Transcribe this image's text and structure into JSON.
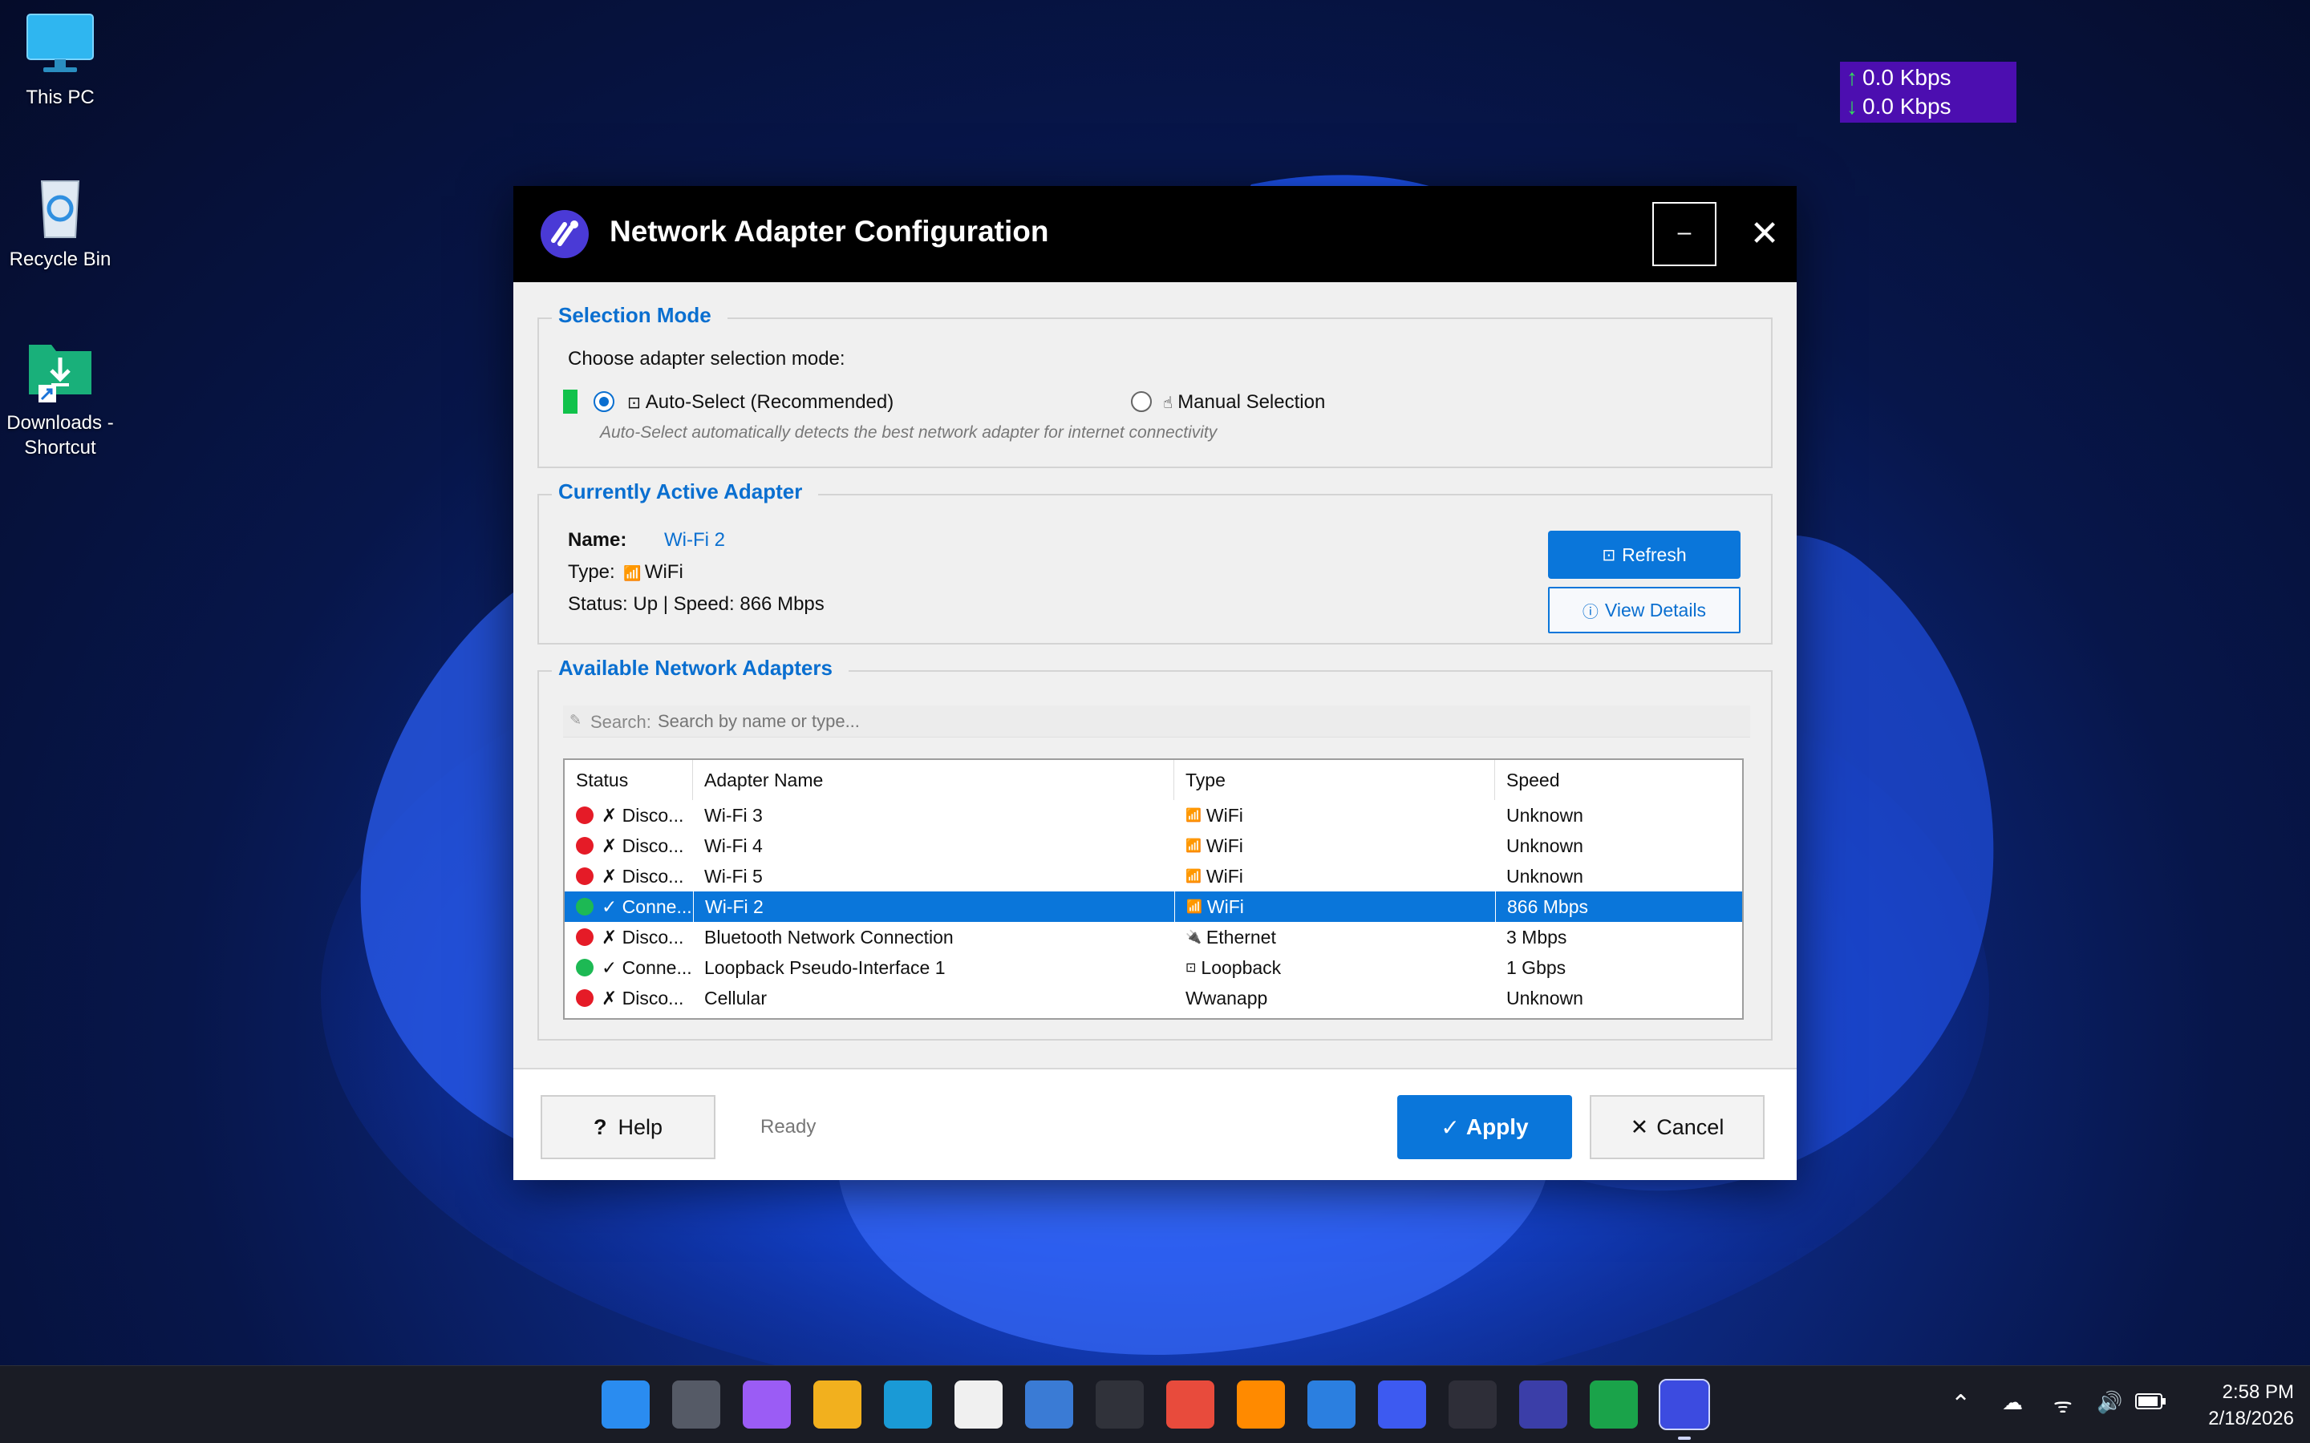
{
  "desktop": {
    "icons": [
      {
        "label": "This PC"
      },
      {
        "label": "Recycle Bin"
      },
      {
        "label": "Downloads - Shortcut"
      }
    ]
  },
  "netspeed": {
    "up": "0.0 Kbps",
    "down": "0.0 Kbps"
  },
  "dialog": {
    "title": "Network Adapter Configuration",
    "minimize_glyph": "–",
    "close_glyph": "✕",
    "selection_mode": {
      "legend": "Selection Mode",
      "prompt": "Choose adapter selection mode:",
      "auto_label": "Auto-Select (Recommended)",
      "auto_icon": "⊡",
      "manual_label": "Manual Selection",
      "manual_icon": "☝",
      "hint": "Auto-Select automatically detects the best network adapter for internet connectivity",
      "selected": "auto"
    },
    "active_adapter": {
      "legend": "Currently Active Adapter",
      "name_label": "Name:",
      "name_value": "Wi-Fi 2",
      "type_label": "Type:",
      "type_icon": "📶",
      "type_value": "WiFi",
      "status_text": "Status: Up | Speed: 866 Mbps",
      "refresh_label": "Refresh",
      "refresh_icon": "⊡",
      "details_label": "View Details",
      "details_icon": "ⓘ"
    },
    "available": {
      "legend": "Available Network Adapters",
      "search_label": "Search:",
      "search_placeholder": "Search by name or type...",
      "search_value": "",
      "columns": [
        "Status",
        "Adapter Name",
        "Type",
        "Speed"
      ],
      "rows": [
        {
          "status_color": "red",
          "status": "✗ Disco...",
          "name": "Wi-Fi 3",
          "type_icon": "📶",
          "type": "WiFi",
          "speed": "Unknown",
          "selected": false
        },
        {
          "status_color": "red",
          "status": "✗ Disco...",
          "name": "Wi-Fi 4",
          "type_icon": "📶",
          "type": "WiFi",
          "speed": "Unknown",
          "selected": false
        },
        {
          "status_color": "red",
          "status": "✗ Disco...",
          "name": "Wi-Fi 5",
          "type_icon": "📶",
          "type": "WiFi",
          "speed": "Unknown",
          "selected": false
        },
        {
          "status_color": "green",
          "status": "✓ Conne...",
          "name": "Wi-Fi 2",
          "type_icon": "📶",
          "type": "WiFi",
          "speed": "866 Mbps",
          "selected": true
        },
        {
          "status_color": "red",
          "status": "✗ Disco...",
          "name": "Bluetooth Network Connection",
          "type_icon": "🔌",
          "type": "Ethernet",
          "speed": "3 Mbps",
          "selected": false
        },
        {
          "status_color": "green",
          "status": "✓ Conne...",
          "name": "Loopback Pseudo-Interface 1",
          "type_icon": "⊡",
          "type": "Loopback",
          "speed": "1 Gbps",
          "selected": false
        },
        {
          "status_color": "red",
          "status": "✗ Disco...",
          "name": "Cellular",
          "type_icon": "",
          "type": "Wwanapp",
          "speed": "Unknown",
          "selected": false
        }
      ]
    },
    "footer": {
      "help_label": "Help",
      "help_icon": "?",
      "status": "Ready",
      "apply_label": "Apply",
      "apply_icon": "✓",
      "cancel_label": "Cancel",
      "cancel_icon": "✕"
    }
  },
  "taskbar": {
    "apps": [
      "start-icon",
      "task-view-icon",
      "copilot-icon",
      "file-explorer-icon",
      "edge-icon",
      "store-icon",
      "control-panel-icon",
      "terminal-icon",
      "chrome-icon",
      "sublime-icon",
      "vscode-icon",
      "remote-desktop-icon",
      "speedometer-icon",
      "system-info-icon",
      "net-updown-icon",
      "network-adapter-app-icon"
    ],
    "tray": [
      "chevron-up-icon",
      "onedrive-icon",
      "wifi-icon",
      "volume-icon",
      "battery-icon"
    ],
    "time": "2:58 PM",
    "date": "2/18/2026"
  },
  "colors": {
    "accent": "#0A76DA",
    "title_bar": "#000000",
    "netspeed_bg": "#4C0EB0",
    "status_red": "#E51B27",
    "status_green": "#1DB954"
  }
}
